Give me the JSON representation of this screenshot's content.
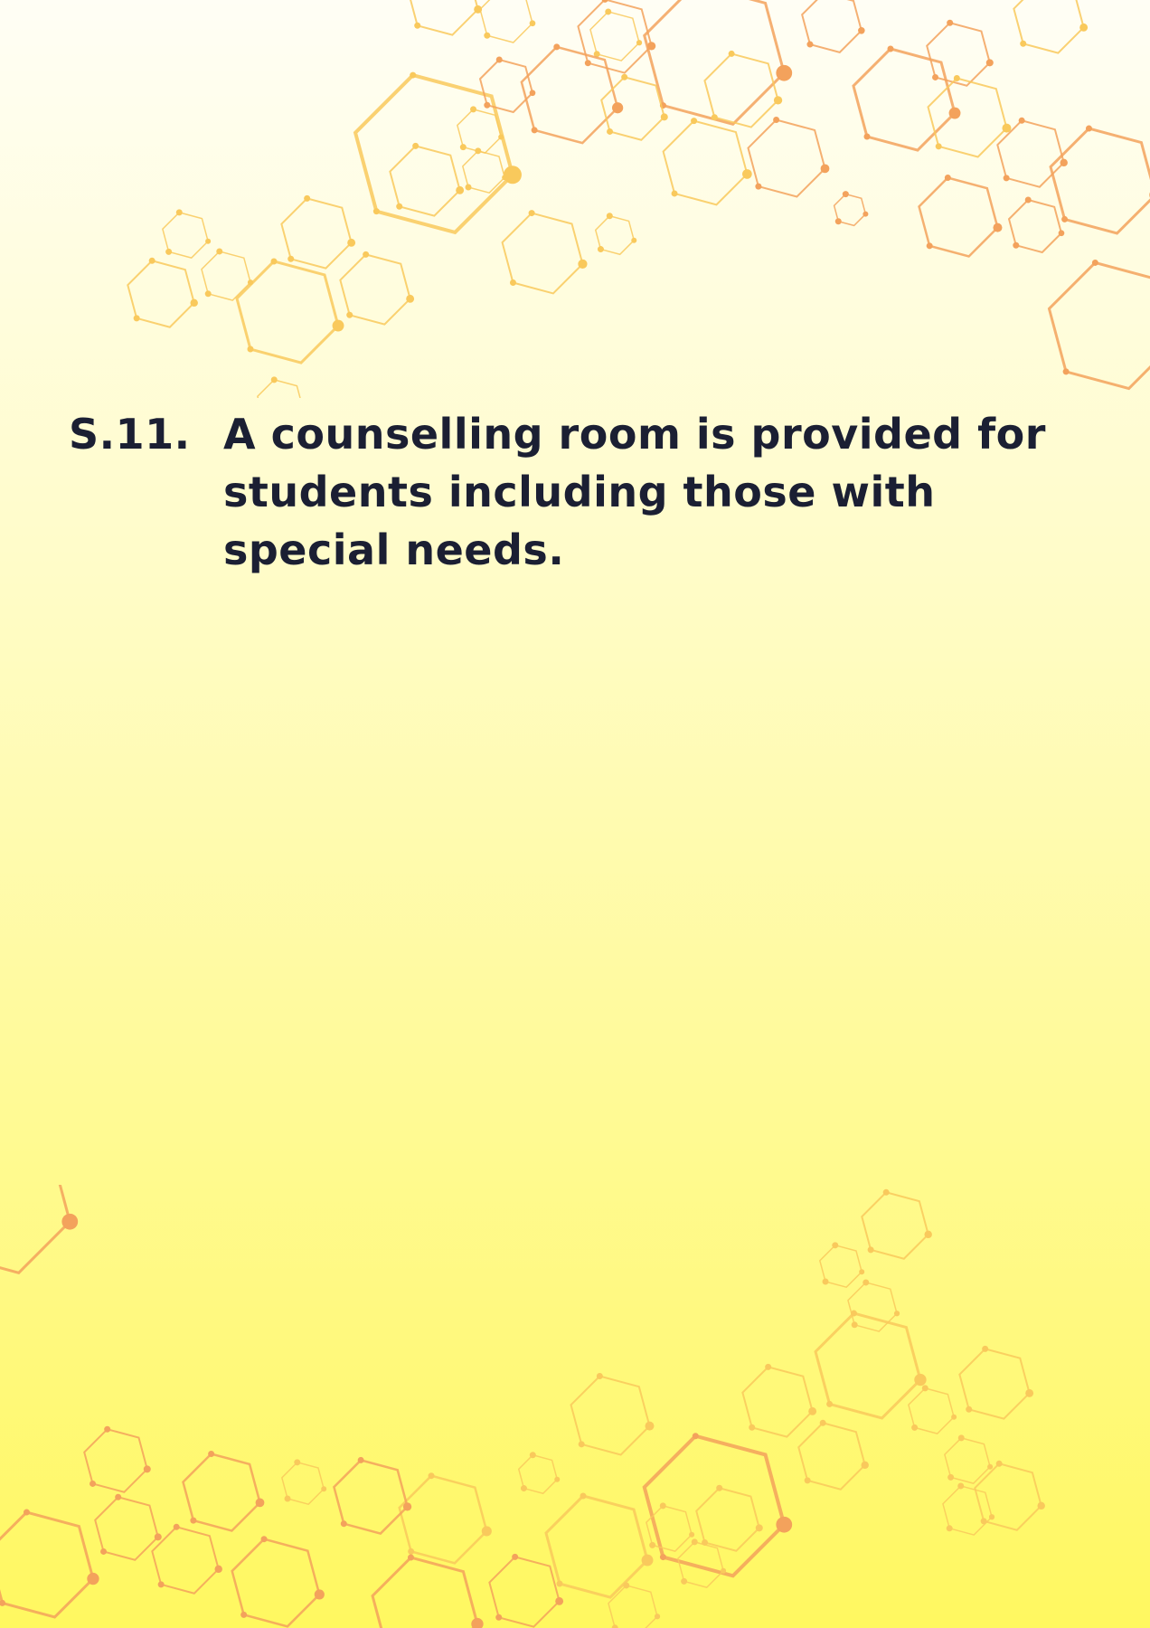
{
  "statement": {
    "number": "S.11.",
    "text": "A counselling room is provided for students including those with special needs."
  },
  "decoration": {
    "name": "hexagon-network-pattern",
    "colors": [
      "#f9c95c",
      "#f3a25c",
      "#f4b86a"
    ]
  }
}
